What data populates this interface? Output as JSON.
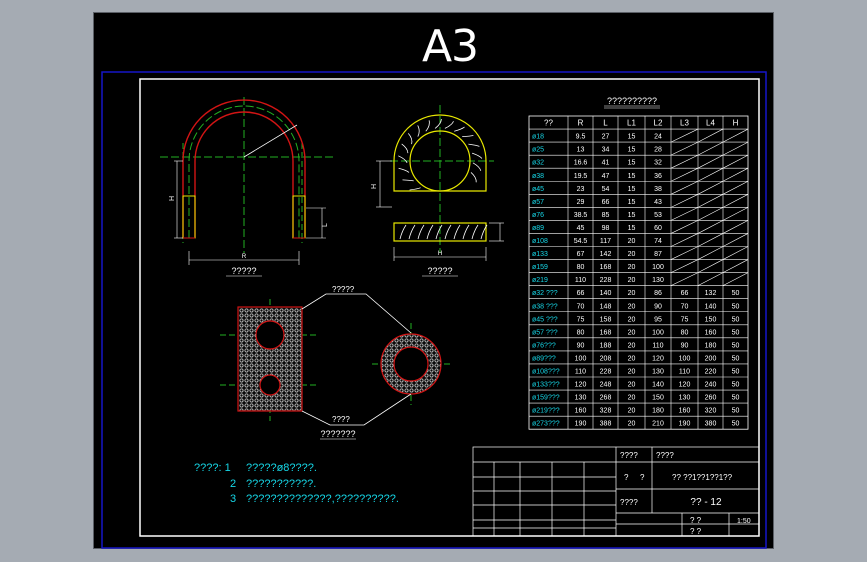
{
  "sheet": {
    "size_label": "A3"
  },
  "colors": {
    "background": "#000000",
    "outer_frame": "#1515c8",
    "inner_frame": "#ffffff",
    "outline": "#d21414",
    "centerline": "#22b022",
    "cyan_text": "#16d6e6",
    "yellow": "#e8e800",
    "hatch": "#cfcfcf"
  },
  "views": {
    "front_caption": "?????",
    "side_caption": "?????",
    "section_callout": "?????",
    "section_callout_2": "????",
    "bottom_caption": "???????",
    "dim_h1": "H",
    "dim_h2": "L",
    "dim_h3": "R",
    "dim_side": "H",
    "dim_side_w": "H"
  },
  "table": {
    "title": "??????????",
    "headers": [
      "??",
      "R",
      "L",
      "L1",
      "L2",
      "L3",
      "L4",
      "H"
    ],
    "rows": [
      [
        "ø18",
        "9.5",
        "27",
        "15",
        "24",
        "",
        "",
        ""
      ],
      [
        "ø25",
        "13",
        "34",
        "15",
        "28",
        "",
        "",
        ""
      ],
      [
        "ø32",
        "16.6",
        "41",
        "15",
        "32",
        "",
        "",
        ""
      ],
      [
        "ø38",
        "19.5",
        "47",
        "15",
        "36",
        "",
        "",
        ""
      ],
      [
        "ø45",
        "23",
        "54",
        "15",
        "38",
        "",
        "",
        ""
      ],
      [
        "ø57",
        "29",
        "66",
        "15",
        "43",
        "",
        "",
        ""
      ],
      [
        "ø76",
        "38.5",
        "85",
        "15",
        "53",
        "",
        "",
        ""
      ],
      [
        "ø89",
        "45",
        "98",
        "15",
        "60",
        "",
        "",
        ""
      ],
      [
        "ø108",
        "54.5",
        "117",
        "20",
        "74",
        "",
        "",
        ""
      ],
      [
        "ø133",
        "67",
        "142",
        "20",
        "87",
        "",
        "",
        ""
      ],
      [
        "ø159",
        "80",
        "168",
        "20",
        "100",
        "",
        "",
        ""
      ],
      [
        "ø219",
        "110",
        "228",
        "20",
        "130",
        "",
        "",
        ""
      ],
      [
        "ø32 ???",
        "66",
        "140",
        "20",
        "86",
        "66",
        "132",
        "50"
      ],
      [
        "ø38 ???",
        "70",
        "148",
        "20",
        "90",
        "70",
        "140",
        "50"
      ],
      [
        "ø45 ???",
        "75",
        "158",
        "20",
        "95",
        "75",
        "150",
        "50"
      ],
      [
        "ø57 ???",
        "80",
        "168",
        "20",
        "100",
        "80",
        "160",
        "50"
      ],
      [
        "ø76???",
        "90",
        "188",
        "20",
        "110",
        "90",
        "180",
        "50"
      ],
      [
        "ø89???",
        "100",
        "208",
        "20",
        "120",
        "100",
        "200",
        "50"
      ],
      [
        "ø108???",
        "110",
        "228",
        "20",
        "130",
        "110",
        "220",
        "50"
      ],
      [
        "ø133???",
        "120",
        "248",
        "20",
        "140",
        "120",
        "240",
        "50"
      ],
      [
        "ø159???",
        "130",
        "268",
        "20",
        "150",
        "130",
        "260",
        "50"
      ],
      [
        "ø219???",
        "160",
        "328",
        "20",
        "180",
        "160",
        "320",
        "50"
      ],
      [
        "ø273???",
        "190",
        "388",
        "20",
        "210",
        "190",
        "380",
        "50"
      ]
    ]
  },
  "notes": {
    "label": "????: 1",
    "line1": "?????ø8????.",
    "num2": "2",
    "line2": "???????????.",
    "num3": "3",
    "line3": "??????????????,??????????."
  },
  "title_block": {
    "r1c1": "????",
    "r1c2": "????",
    "r2a": "?",
    "r2b": "?",
    "r2c": "?? ??1??1??1??",
    "r3a": "????",
    "drawing_no": "?? - 12",
    "r4a": "?  ?",
    "scale": "1:50",
    "r5a": "?  ?"
  }
}
